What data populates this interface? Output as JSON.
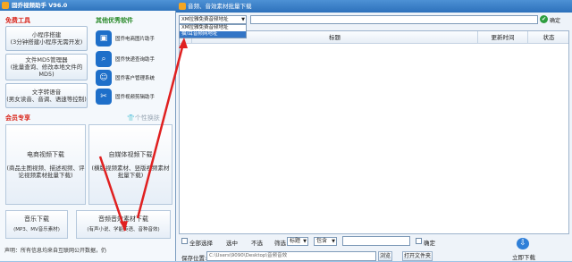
{
  "left": {
    "title": "固乔视频助手 V96.0",
    "free_tools": "免费工具",
    "other_software": "其他优秀软件",
    "tool1": "小程序搭建\n(3分钟搭建小程序无需开发)",
    "tool2": "文件MD5管理器\n(批量查询、修改本地文件的MD5)",
    "tool3": "文字转语音\n(男女读音、音调、语速等控制)",
    "soft": [
      {
        "icon": "cart-icon",
        "label": "固乔电商图片助手"
      },
      {
        "icon": "search-icon",
        "label": "固乔快递查询助手"
      },
      {
        "icon": "people-icon",
        "label": "固乔客户管理系统"
      },
      {
        "icon": "scissors-icon",
        "label": "固乔视频剪辑助手"
      }
    ],
    "vip": "会员专享",
    "skin": "个性换肤",
    "p1_title": "电商视频下载",
    "p1_sub": "(商品主图视频、描述视频、评论视频素材批量下载)",
    "p2_title": "自媒体视频下载",
    "p2_sub": "(横版视频素材、竖版视频素材批量下载)",
    "p3_title": "音乐下载",
    "p3_sub": "(MP3、MV音乐素材)",
    "p4_title": "音频音效素材下载",
    "p4_sub": "(有声小说、学能英语、音种音效)",
    "hint": "声明：所有信息均来自互联网公开数据，仍"
  },
  "right": {
    "title": "音频、音效素材批量下载",
    "combo_value": "XM拉雅免费音频地址",
    "dropdown": [
      "XM拉雅免费音频地址",
      "猫/耳音频网地址"
    ],
    "confirm": "确定",
    "headers": [
      "标题",
      "更新时间",
      "状态"
    ],
    "bottom": {
      "select_all": "全部选择",
      "select_mid": "选中",
      "no_select": "不选",
      "filter": "筛选",
      "field": "标题",
      "op": "包含",
      "confirm": "确定",
      "save_label": "保存位置:",
      "save_path": "C:\\Users\\9090\\Desktop\\音频音效",
      "browse": "浏览",
      "open_folder": "打开文件夹",
      "download": "立即下载"
    }
  },
  "colors": {
    "accent": "#2f74bd",
    "vip": "#d9261c",
    "free": "#d9261c",
    "arrow": "#e02020"
  }
}
